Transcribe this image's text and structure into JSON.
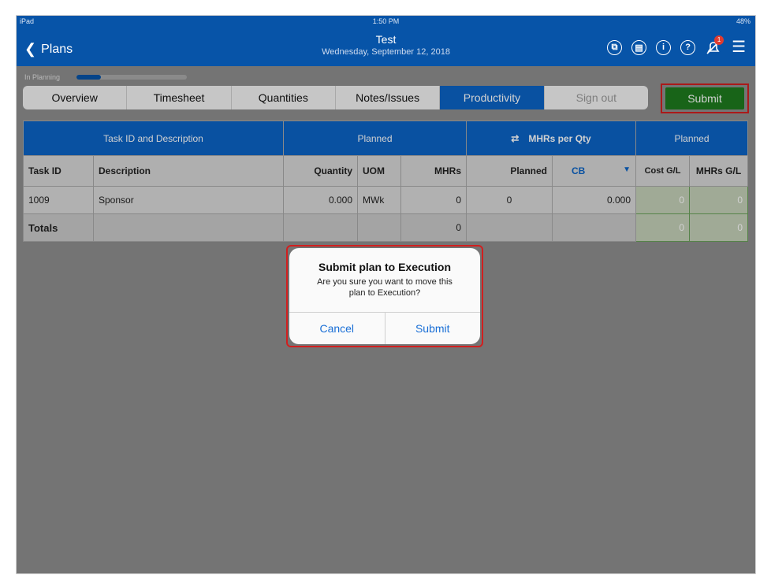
{
  "status_bar": {
    "left": "iPad",
    "time": "1:50 PM",
    "battery": "48%"
  },
  "nav": {
    "back_label": "Plans",
    "title": "Test",
    "subtitle": "Wednesday, September 12, 2018",
    "notification_count": "1"
  },
  "progress": {
    "label": "In Planning",
    "fraction": 0.22
  },
  "tabs": [
    {
      "label": "Overview"
    },
    {
      "label": "Timesheet"
    },
    {
      "label": "Quantities"
    },
    {
      "label": "Notes/Issues"
    },
    {
      "label": "Productivity"
    },
    {
      "label": "Sign out"
    }
  ],
  "submit_label": "Submit",
  "table": {
    "group_headers": {
      "task": "Task ID and Description",
      "planned1": "Planned",
      "mhrs_per_qty": "MHRs per Qty",
      "planned2": "Planned"
    },
    "columns": {
      "task_id": "Task ID",
      "description": "Description",
      "quantity": "Quantity",
      "uom": "UOM",
      "mhrs": "MHRs",
      "planned": "Planned",
      "cb": "CB",
      "cost_gl": "Cost G/L",
      "mhrs_gl": "MHRs G/L"
    },
    "row": {
      "task_id": "1009",
      "description": "Sponsor",
      "quantity": "0.000",
      "uom": "MWk",
      "mhrs": "0",
      "planned": "0",
      "cb": "0.000",
      "cost_gl": "0",
      "mhrs_gl": "0"
    },
    "totals": {
      "label": "Totals",
      "mhrs": "0",
      "cost_gl": "0",
      "mhrs_gl": "0"
    }
  },
  "dialog": {
    "title": "Submit plan to Execution",
    "message": "Are you sure you want to move this plan to Execution?",
    "cancel": "Cancel",
    "submit": "Submit"
  },
  "colors": {
    "brand_blue": "#0754a8",
    "active_tab": "#0b63c5",
    "submit_green": "#1e7b1e",
    "highlight_red": "#d11f1f"
  }
}
